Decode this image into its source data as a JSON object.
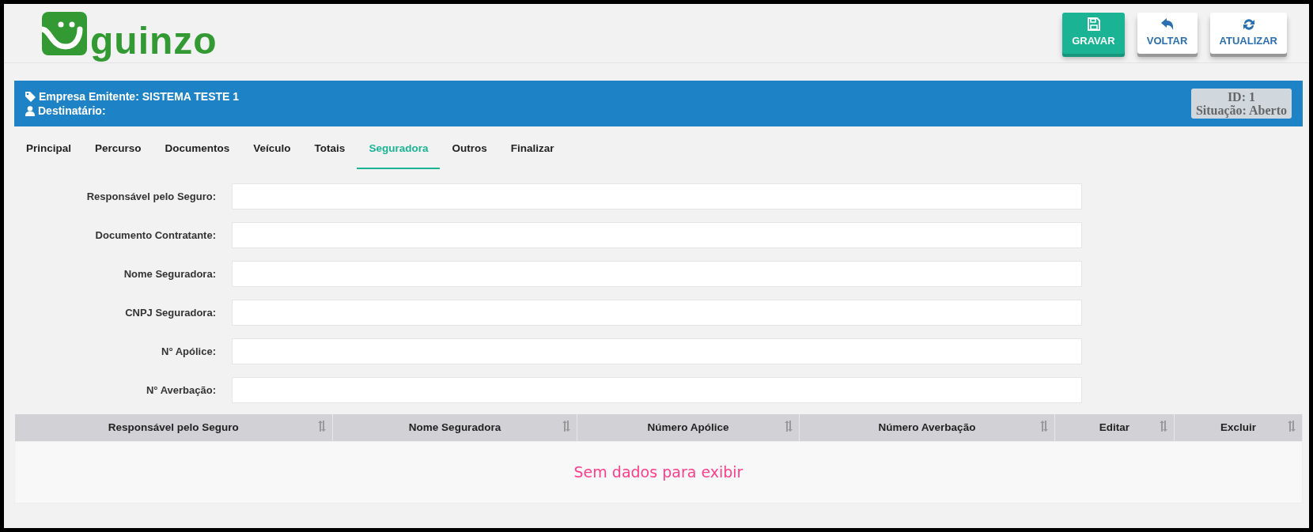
{
  "header": {
    "logo_text": "guinzo",
    "buttons": [
      {
        "label": "GRAVAR",
        "kind": "save"
      },
      {
        "label": "VOLTAR",
        "kind": "back"
      },
      {
        "label": "ATUALIZAR",
        "kind": "refresh"
      }
    ]
  },
  "info_bar": {
    "emitente": "Empresa Emitente: SISTEMA TESTE 1",
    "destinatario": "Destinatário:",
    "id": "ID: 1",
    "situacao": "Situação: Aberto"
  },
  "tabs": [
    {
      "label": "Principal",
      "selected": false
    },
    {
      "label": "Percurso",
      "selected": false
    },
    {
      "label": "Documentos",
      "selected": false
    },
    {
      "label": "Veículo",
      "selected": false
    },
    {
      "label": "Totais",
      "selected": false
    },
    {
      "label": "Seguradora",
      "selected": true
    },
    {
      "label": "Outros",
      "selected": false
    },
    {
      "label": "Finalizar",
      "selected": false
    }
  ],
  "form": {
    "fields": [
      {
        "label": "Responsável pelo Seguro:"
      },
      {
        "label": "Documento Contratante:"
      },
      {
        "label": "Nome Seguradora:"
      },
      {
        "label": "CNPJ Seguradora:"
      },
      {
        "label": "N° Apólice:"
      },
      {
        "label": "N° Averbação:"
      }
    ]
  },
  "table": {
    "columns": [
      "Responsável pelo Seguro",
      "Nome Seguradora",
      "Número Apólice",
      "Número Averbação",
      "Editar",
      "Excluir"
    ],
    "empty_message": "Sem dados para exibir"
  }
}
